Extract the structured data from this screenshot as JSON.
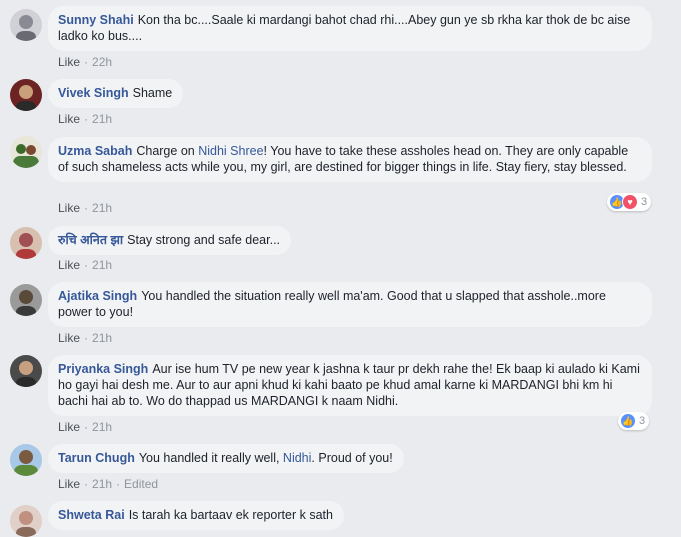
{
  "actions": {
    "like_label": "Like",
    "edited_label": "Edited",
    "separator": "·"
  },
  "comments": [
    {
      "author": "Sunny Shahi",
      "text": "Kon tha bc....Saale ki mardangi bahot chad rhi....Abey gun ye sb rkha kar thok de bc aise ladko ko bus....",
      "time": "22h",
      "avatar_color": "#b8b8c0"
    },
    {
      "author": "Vivek Singh",
      "text": "Shame",
      "time": "21h",
      "avatar_color": "#7a2a2a"
    },
    {
      "author": "Uzma Sabah",
      "text_before": "Charge on ",
      "mention": "Nidhi Shree",
      "text_after": "! You have to take these assholes head on. They are only capable of such shameless acts while you, my girl, are destined for bigger things in life. Stay fiery, stay blessed.",
      "time": "21h",
      "reactions": {
        "icons": [
          "like-icon",
          "love-icon"
        ],
        "count": "3"
      },
      "avatar_color": "#4a7a3a"
    },
    {
      "author": "रुचि अनित झा",
      "text": "Stay strong and safe dear...",
      "time": "21h",
      "avatar_color": "#a05050"
    },
    {
      "author": "Ajatika Singh",
      "text": "You handled the situation really well ma'am. Good that u slapped that asshole..more power to you!",
      "time": "21h",
      "avatar_color": "#3a3a3a"
    },
    {
      "author": "Priyanka Singh",
      "text": "Aur ise hum TV pe new year k jashna k taur pr dekh rahe the! Ek baap ki aulado ki Kami ho gayi hai desh me. Aur to aur apni khud ki kahi baato pe khud amal karne ki MARDANGI bhi km hi bachi hai ab to. Wo do thappad us MARDANGI k naam Nidhi.",
      "time": "21h",
      "reactions": {
        "icons": [
          "like-icon"
        ],
        "count": "3"
      },
      "avatar_color": "#2e2a2a"
    },
    {
      "author": "Tarun Chugh",
      "text_before": "You handled it really well, ",
      "mention": "Nidhi",
      "text_after": ". Proud of you!",
      "time": "21h",
      "edited": true,
      "avatar_color": "#5a8a3a"
    },
    {
      "author": "Shweta Rai",
      "text": "Is tarah ka bartaav ek reporter k sath",
      "avatar_color": "#c09080"
    }
  ],
  "colors": {
    "author": "#365899",
    "meta": "#90949c",
    "bubble": "#f2f3f5",
    "background": "#e9ebee"
  }
}
